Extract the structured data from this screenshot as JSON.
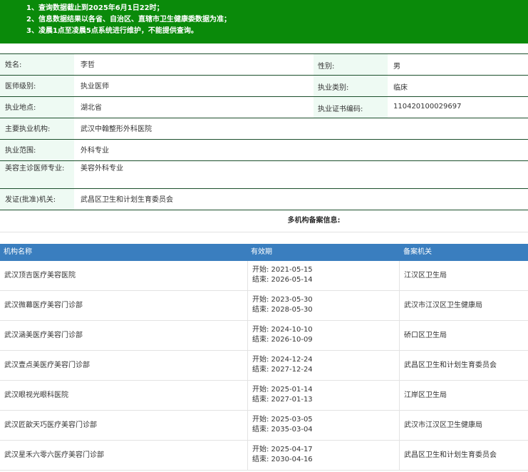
{
  "notice": {
    "lines": [
      "1、查询数据截止到2025年6月1日22时；",
      "2、信息数据结果以各省、自治区、直辖市卫生健康委数据为准；",
      "3、凌晨1点至凌晨5点系统进行维护，不能提供查询。"
    ]
  },
  "doctor": {
    "name_label": "姓名:",
    "name": "李哲",
    "gender_label": "性别:",
    "gender": "男",
    "level_label": "医师级别:",
    "level": "执业医师",
    "category_label": "执业类别:",
    "category": "临床",
    "location_label": "执业地点:",
    "location": "湖北省",
    "cert_label": "执业证书编码:",
    "cert": "110420100029697",
    "org_label": "主要执业机构:",
    "org": "武汉中翰整形外科医院",
    "scope_label": "执业范围:",
    "scope": "外科专业",
    "cosmetic_label": "美容主诊医师专业:",
    "cosmetic": "美容外科专业",
    "issuer_label": "发证(批准)机关:",
    "issuer": "武昌区卫生和计划生育委员会"
  },
  "multi": {
    "title": "多机构备案信息:",
    "headers": [
      "机构名称",
      "有效期",
      "备案机关"
    ],
    "rows": [
      {
        "name": "武汉顶吉医疗美容医院",
        "start": "开始: 2021-05-15",
        "end": "结束: 2026-05-14",
        "authority": "江汉区卫生局"
      },
      {
        "name": "武汉微幕医疗美容门诊部",
        "start": "开始: 2023-05-30",
        "end": "结束: 2028-05-30",
        "authority": "武汉市江汉区卫生健康局"
      },
      {
        "name": "武汉涵美医疗美容门诊部",
        "start": "开始: 2024-10-10",
        "end": "结束: 2026-10-09",
        "authority": "硚口区卫生局"
      },
      {
        "name": "武汉壹点美医疗美容门诊部",
        "start": "开始: 2024-12-24",
        "end": "结束: 2027-12-24",
        "authority": "武昌区卫生和计划生育委员会"
      },
      {
        "name": "武汉眼视光眼科医院",
        "start": "开始: 2025-01-14",
        "end": "结束: 2027-01-13",
        "authority": "江岸区卫生局"
      },
      {
        "name": "武汉匠歆天巧医疗美容门诊部",
        "start": "开始: 2025-03-05",
        "end": "结束: 2035-03-04",
        "authority": "武汉市江汉区卫生健康局"
      },
      {
        "name": "武汉星禾六零六医疗美容门诊部",
        "start": "开始: 2025-04-17",
        "end": "结束: 2030-04-16",
        "authority": "武昌区卫生和计划生育委员会"
      }
    ]
  }
}
